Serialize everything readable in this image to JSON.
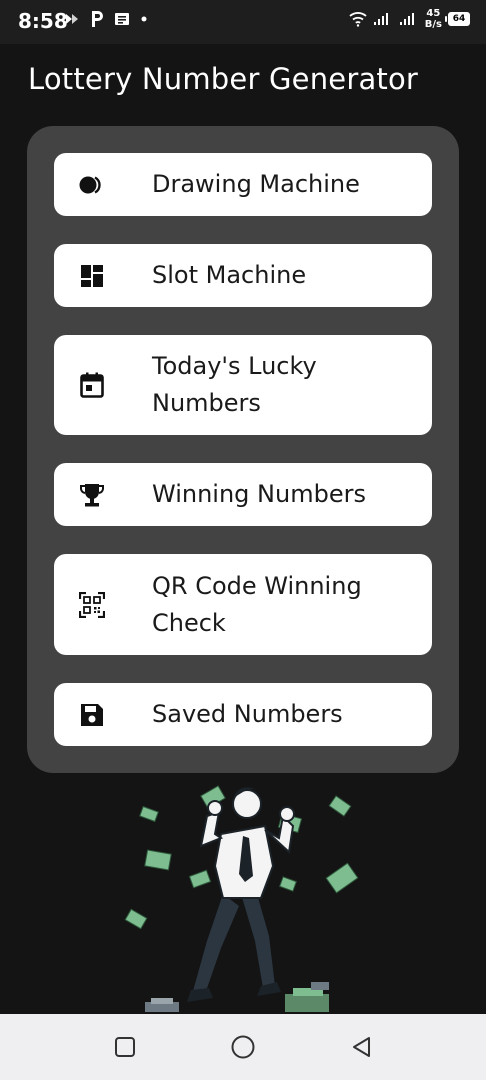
{
  "status_bar": {
    "time": "8:58",
    "speed_value": "45",
    "speed_unit": "B/s",
    "battery": "64"
  },
  "header": {
    "title": "Lottery Number Generator"
  },
  "menu": {
    "items": [
      {
        "label": "Drawing Machine",
        "icon": "toggle-icon"
      },
      {
        "label": "Slot Machine",
        "icon": "dashboard-icon"
      },
      {
        "label": "Today's Lucky Numbers",
        "icon": "calendar-icon"
      },
      {
        "label": "Winning Numbers",
        "icon": "trophy-icon"
      },
      {
        "label": "QR Code Winning Check",
        "icon": "qr-code-icon"
      },
      {
        "label": "Saved Numbers",
        "icon": "save-icon"
      }
    ]
  },
  "colors": {
    "background": "#141414",
    "panel": "#434343",
    "button": "#ffffff",
    "money": "#7dbd8f"
  }
}
